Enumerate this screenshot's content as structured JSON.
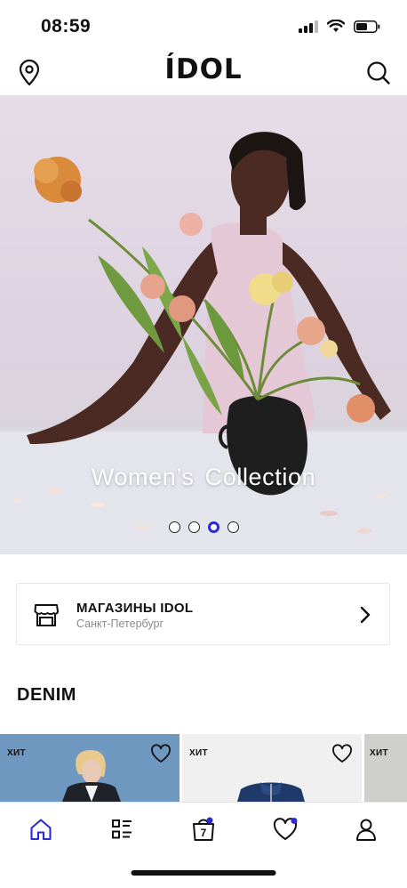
{
  "status_bar": {
    "time": "08:59"
  },
  "header": {
    "logo": "ÍDOL",
    "location_icon": "map-pin-icon",
    "search_icon": "search-icon"
  },
  "hero": {
    "caption": "Women’s Collection",
    "slide_count": 4,
    "active_slide": 3
  },
  "store": {
    "title": "МАГАЗИНЫ IDOL",
    "city": "Санкт-Петербург",
    "icon": "store-icon"
  },
  "section": {
    "title": "DENIM"
  },
  "products": [
    {
      "tag": "ХИТ"
    },
    {
      "tag": "ХИТ"
    },
    {
      "tag": "ХИТ"
    }
  ],
  "tabbar": {
    "items": [
      {
        "icon": "home-icon",
        "active": true
      },
      {
        "icon": "catalog-icon",
        "active": false
      },
      {
        "icon": "shopping-bag-icon",
        "badge": "7",
        "active": false
      },
      {
        "icon": "heart-icon",
        "active": false
      },
      {
        "icon": "profile-icon",
        "active": false
      }
    ]
  },
  "colors": {
    "accent": "#2b2bd6",
    "text": "#111111",
    "muted": "#8a8a8a"
  }
}
